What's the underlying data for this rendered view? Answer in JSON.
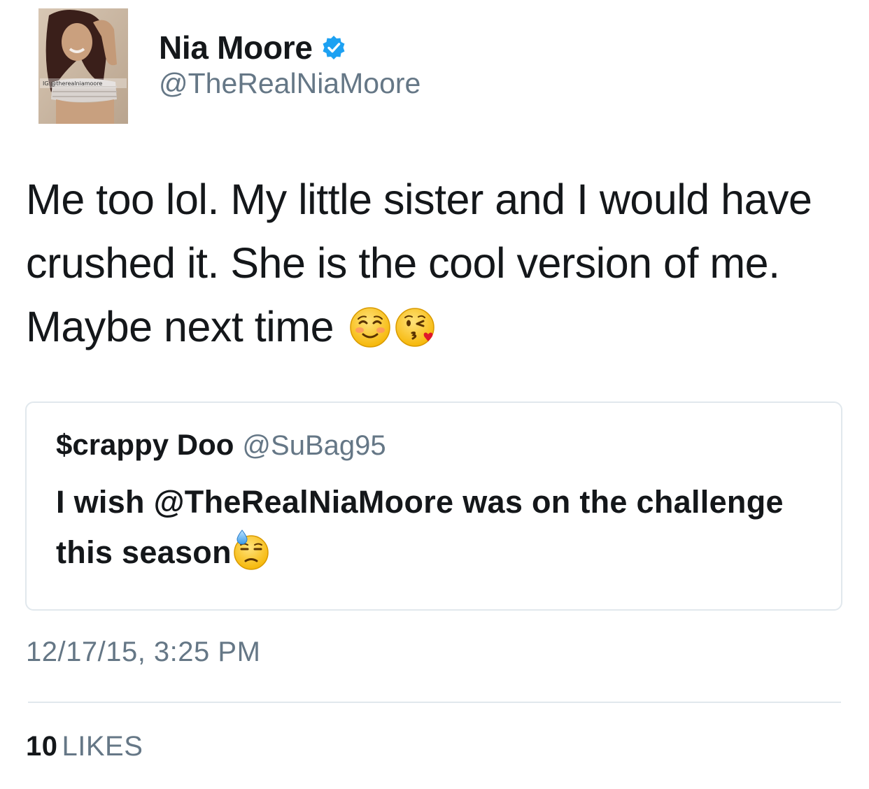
{
  "author": {
    "display_name": "Nia Moore",
    "handle": "@TheRealNiaMoore",
    "verified": true,
    "avatar_watermark": "IG:@therealniamoore"
  },
  "tweet": {
    "text": "Me too lol. My little sister and I would have crushed it. She is the cool version of me. Maybe next time",
    "emojis": [
      "smiling-face-icon",
      "face-blowing-kiss-icon"
    ]
  },
  "quoted_tweet": {
    "display_name": "$crappy Doo",
    "handle": "@SuBag95",
    "text": "I wish @TheRealNiaMoore was on the challenge this season",
    "emoji": "downcast-sweat-face-icon"
  },
  "timestamp": "12/17/15, 3:25 PM",
  "likes": {
    "count": "10",
    "label": "LIKES"
  },
  "colors": {
    "text": "#14171a",
    "secondary": "#657786",
    "verified_blue": "#1da1f2",
    "border": "#e1e8ed"
  }
}
